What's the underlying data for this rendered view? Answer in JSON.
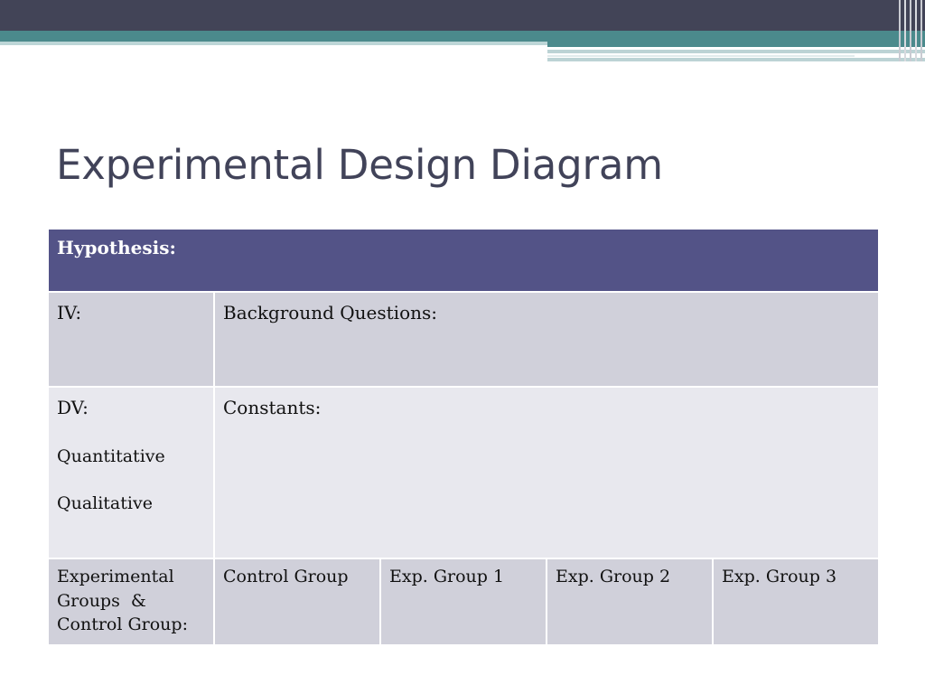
{
  "slide": {
    "title": "Experimental Design Diagram"
  },
  "table": {
    "hypothesis_label": "Hypothesis:",
    "iv_label": "IV:",
    "background_label": "Background Questions:",
    "dv_label": "DV:",
    "dv_quantitative": "Quantitative",
    "dv_qualitative": "Qualitative",
    "constants_label": "Constants:",
    "groups_label_line1": "Experimental",
    "groups_label_line2": "Groups  &",
    "groups_label_line3": "Control Group:",
    "group_columns": [
      "Control Group",
      "Exp. Group 1",
      "Exp. Group 2",
      "Exp. Group 3"
    ]
  },
  "colors": {
    "header_dark": "#424457",
    "header_teal": "#4b8a8c",
    "title_text": "#414359",
    "hypothesis_row": "#535387",
    "row_medium": "#d0d0da",
    "row_light": "#e8e8ee"
  }
}
